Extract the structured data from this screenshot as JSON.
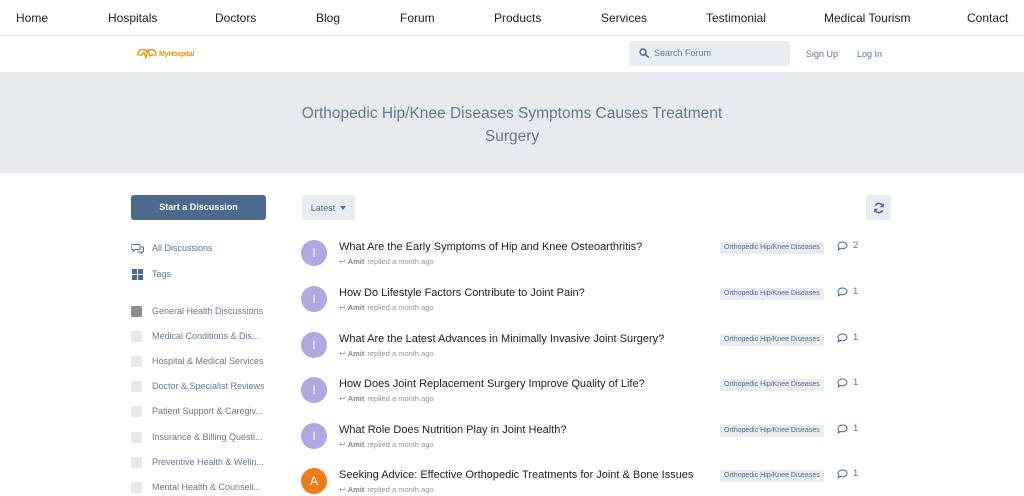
{
  "top_nav": [
    {
      "label": "Home",
      "key": "home"
    },
    {
      "label": "Hospitals",
      "key": "hospitals"
    },
    {
      "label": "Doctors",
      "key": "doctors"
    },
    {
      "label": "Blog",
      "key": "blog"
    },
    {
      "label": "Forum",
      "key": "forum"
    },
    {
      "label": "Products",
      "key": "products"
    },
    {
      "label": "Services",
      "key": "services"
    },
    {
      "label": "Testimonial",
      "key": "testimonial"
    },
    {
      "label": "Medical Tourism",
      "key": "medical-tourism"
    },
    {
      "label": "Contact",
      "key": "contact"
    }
  ],
  "header": {
    "logo_text": "MyHospital",
    "search_placeholder": "Search Forum",
    "sign_up": "Sign Up",
    "log_in": "Log In"
  },
  "hero": {
    "title": "Orthopedic Hip/Knee Diseases Symptoms Causes Treatment Surgery"
  },
  "sidebar": {
    "start_button": "Start a Discussion",
    "all_discussions": "All Discussions",
    "tags": "Tags",
    "tag_items": [
      {
        "label": "General Health Discussions",
        "active": true
      },
      {
        "label": "Medical Conditions & Dis...",
        "active": false
      },
      {
        "label": "Hospital & Medical Services",
        "active": false
      },
      {
        "label": "Doctor & Specialist Reviews",
        "active": false
      },
      {
        "label": "Patient Support & Caregiv...",
        "active": false
      },
      {
        "label": "Insurance & Billing Questi...",
        "active": false
      },
      {
        "label": "Preventive Health & Welln...",
        "active": false
      },
      {
        "label": "Mental Health & Counseli...",
        "active": false
      }
    ]
  },
  "toolbar": {
    "sort_label": "Latest"
  },
  "discussions": [
    {
      "avatar": "I",
      "avatar_color": "#b3a7e3",
      "title": "What Are the Early Symptoms of Hip and Knee Osteoarthritis?",
      "author": "Amit",
      "meta": "replied a month ago",
      "tag": "Orthopedic Hip/Knee Diseases",
      "replies": "2"
    },
    {
      "avatar": "I",
      "avatar_color": "#b3a7e3",
      "title": "How Do Lifestyle Factors Contribute to Joint Pain?",
      "author": "Amit",
      "meta": "replied a month ago",
      "tag": "Orthopedic Hip/Knee Diseases",
      "replies": "1"
    },
    {
      "avatar": "I",
      "avatar_color": "#b3a7e3",
      "title": "What Are the Latest Advances in Minimally Invasive Joint Surgery?",
      "author": "Amit",
      "meta": "replied a month ago",
      "tag": "Orthopedic Hip/Knee Diseases",
      "replies": "1"
    },
    {
      "avatar": "I",
      "avatar_color": "#b3a7e3",
      "title": "How Does Joint Replacement Surgery Improve Quality of Life?",
      "author": "Amit",
      "meta": "replied a month ago",
      "tag": "Orthopedic Hip/Knee Diseases",
      "replies": "1"
    },
    {
      "avatar": "I",
      "avatar_color": "#b3a7e3",
      "title": "What Role Does Nutrition Play in Joint Health?",
      "author": "Amit",
      "meta": "replied a month ago",
      "tag": "Orthopedic Hip/Knee Diseases",
      "replies": "1"
    },
    {
      "avatar": "A",
      "avatar_color": "#ef7d1a",
      "title": "Seeking Advice: Effective Orthopedic Treatments for Joint & Bone Issues",
      "author": "Amit",
      "meta": "replied a month ago",
      "tag": "Orthopedic Hip/Knee Diseases",
      "replies": "1"
    }
  ],
  "colors": {
    "accent": "#4d698e",
    "hero_bg": "#e7ebf0",
    "logo": "#e89400"
  }
}
